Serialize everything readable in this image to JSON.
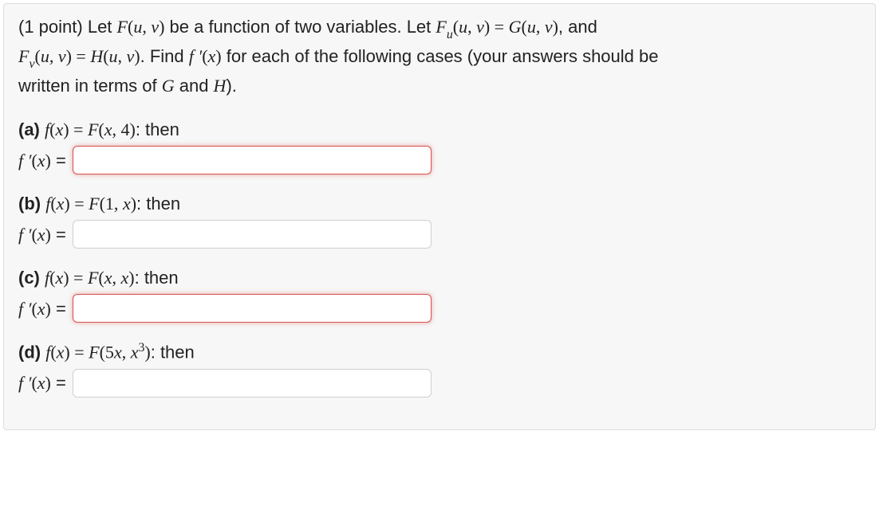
{
  "intro": {
    "points_prefix": "(1 point) ",
    "line1_a": "Let ",
    "line1_b": " be a function of two variables. Let ",
    "line1_c": ", and",
    "line2_a": ". Find ",
    "line2_b": " for each of the following cases (your answers should be",
    "line3": "written in terms of ",
    "line3_mid": " and ",
    "line3_end": ")."
  },
  "labels": {
    "a": "(a) ",
    "b": "(b) ",
    "c": "(c) ",
    "d": "(d) ",
    "then": ": then",
    "fprime_eq": " ="
  },
  "parts": {
    "a": {
      "def": "F(x, 4)",
      "value": "",
      "invalid": true
    },
    "b": {
      "def": "F(1, x)",
      "value": "",
      "invalid": false
    },
    "c": {
      "def": "F(x, x)",
      "value": "",
      "invalid": true
    },
    "d": {
      "def_pre": "F(5x, x",
      "def_sup": "3",
      "def_post": ")",
      "value": "",
      "invalid": false
    }
  }
}
